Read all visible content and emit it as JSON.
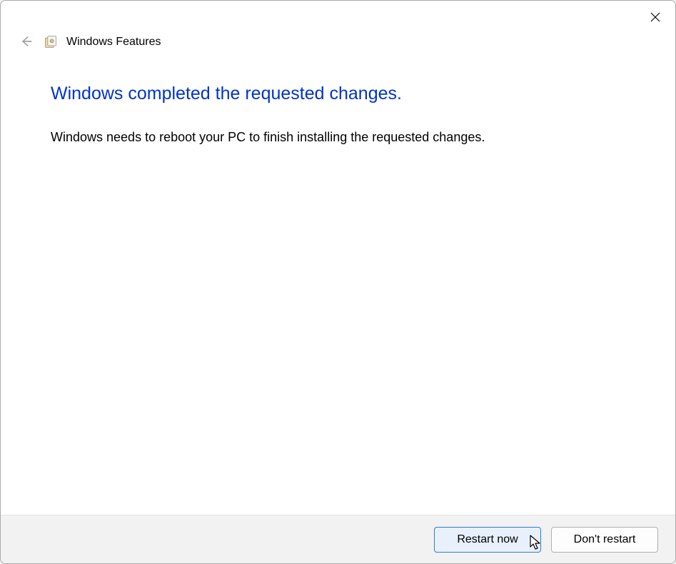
{
  "header": {
    "title": "Windows Features"
  },
  "main": {
    "heading": "Windows completed the requested changes.",
    "body": "Windows needs to reboot your PC to finish installing the requested changes."
  },
  "footer": {
    "primary_label": "Restart now",
    "secondary_label": "Don't restart"
  }
}
